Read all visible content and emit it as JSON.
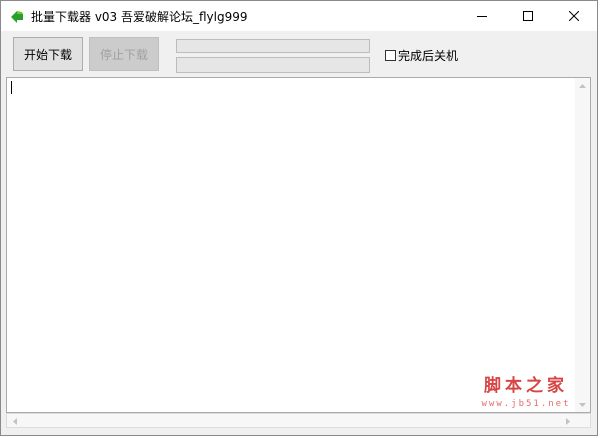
{
  "window": {
    "title": "批量下载器  v03  吾爱破解论坛_flylg999"
  },
  "toolbar": {
    "start_label": "开始下载",
    "stop_label": "停止下载",
    "shutdown_label": "完成后关机",
    "shutdown_checked": false,
    "progress_1": 0,
    "progress_2": 0
  },
  "log": {
    "text": ""
  },
  "watermark": {
    "site_name": "脚本之家",
    "site_url": "www.jb51.net"
  },
  "icons": {
    "app": "download-arrow-icon",
    "minimize": "minimize-icon",
    "maximize": "maximize-icon",
    "close": "close-icon"
  },
  "colors": {
    "accent_green": "#2a9d2a",
    "watermark_red": "#d84545"
  }
}
